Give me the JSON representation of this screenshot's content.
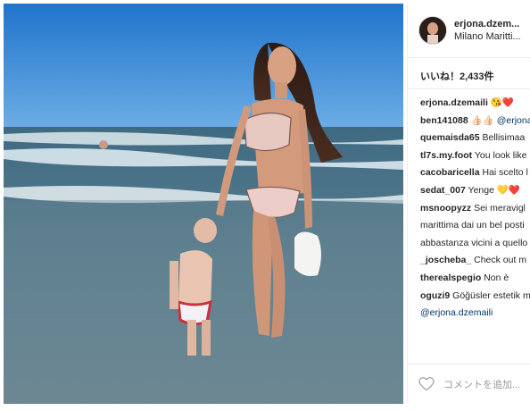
{
  "post": {
    "username": "erjona.dzem...",
    "location": "Milano Maritti...",
    "likes_label": "いいね！2,433件",
    "add_comment_placeholder": "コメントを追加..."
  },
  "comments": [
    {
      "user": "erjona.dzemaili",
      "text": "😘❤️"
    },
    {
      "user": "ben141088",
      "text": "👍🏻👍🏻",
      "mention": "@erjona"
    },
    {
      "user": "quemaisda65",
      "text": "Bellisimaa"
    },
    {
      "user": "tl7s.my.foot",
      "text": "You look like"
    },
    {
      "user": "cacobaricella",
      "text": "Hai scelto l"
    },
    {
      "user": "sedat_007",
      "text": "Yenge 💛❤️"
    },
    {
      "user": "msnoopyzz",
      "text": "Sei meravigl"
    },
    {
      "user": "",
      "text": "marittima dai un bel posti"
    },
    {
      "user": "",
      "text": "abbastanza vicini a quello"
    },
    {
      "user": "_joscheba_",
      "text": "Check out m"
    },
    {
      "user": "therealspegio",
      "text": "Non è"
    },
    {
      "user": "oguzi9",
      "text": "Göğüsler estetik m"
    },
    {
      "user": "",
      "text": "",
      "mention": "@erjona.dzemaili"
    }
  ],
  "colors": {
    "accent": "#003569",
    "sky": "#2f86d6",
    "sea": "#4f7386"
  }
}
